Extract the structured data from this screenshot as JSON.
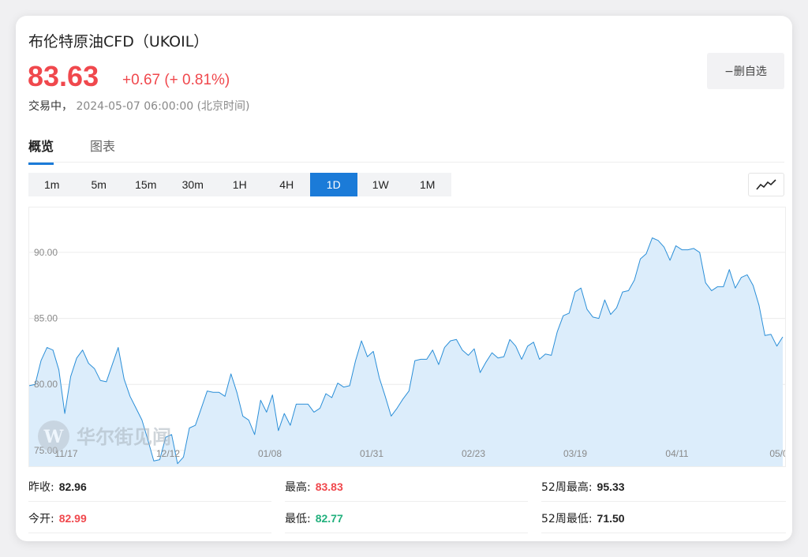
{
  "instrument": {
    "title": "布伦特原油CFD（UKOIL）",
    "price": "83.63",
    "change": "+0.67 (+ 0.81%)",
    "status_label": "交易中，",
    "timestamp": "2024-05-07 06:00:00 (北京时间)",
    "watch_label": "−删自选"
  },
  "tabs": [
    {
      "label": "概览",
      "active": true
    },
    {
      "label": "图表",
      "active": false
    }
  ],
  "periods": [
    {
      "label": "1m",
      "active": false
    },
    {
      "label": "5m",
      "active": false
    },
    {
      "label": "15m",
      "active": false
    },
    {
      "label": "30m",
      "active": false
    },
    {
      "label": "1H",
      "active": false
    },
    {
      "label": "4H",
      "active": false
    },
    {
      "label": "1D",
      "active": true
    },
    {
      "label": "1W",
      "active": false
    },
    {
      "label": "1M",
      "active": false
    }
  ],
  "chart_type_icon": "line-chart-icon",
  "watermark": "华尔街见闻",
  "stats": {
    "prev_close": {
      "label": "昨收:",
      "value": "82.96"
    },
    "high": {
      "label": "最高:",
      "value": "83.83"
    },
    "high52": {
      "label": "52周最高:",
      "value": "95.33"
    },
    "open": {
      "label": "今开:",
      "value": "82.99"
    },
    "low": {
      "label": "最低:",
      "value": "82.77"
    },
    "low52": {
      "label": "52周最低:",
      "value": "71.50"
    }
  },
  "colors": {
    "up": "#f0484d",
    "down": "#22b07d",
    "accent": "#1b7bd8",
    "line": "#2b8fd8",
    "fill": "#dcedfb"
  },
  "chart_data": {
    "type": "area",
    "y_ticks": [
      "75.00",
      "80.00",
      "85.00",
      "90.00"
    ],
    "x_ticks": [
      "11/17",
      "12/12",
      "01/08",
      "01/31",
      "02/23",
      "03/19",
      "04/11",
      "05/0"
    ],
    "ylim": [
      73.8,
      93.4
    ],
    "grid": true,
    "values": [
      79.9,
      80.0,
      81.8,
      82.8,
      82.6,
      81.1,
      77.8,
      80.6,
      82.0,
      82.6,
      81.6,
      81.2,
      80.3,
      80.2,
      81.5,
      82.8,
      80.4,
      79.1,
      78.2,
      77.3,
      75.8,
      74.2,
      74.3,
      76.0,
      76.2,
      74.0,
      74.5,
      76.7,
      76.9,
      78.2,
      79.5,
      79.4,
      79.4,
      79.1,
      80.8,
      79.4,
      77.6,
      77.3,
      76.2,
      78.8,
      77.9,
      79.2,
      76.5,
      77.8,
      76.9,
      78.5,
      78.5,
      78.5,
      77.9,
      78.2,
      79.3,
      79.0,
      80.1,
      79.8,
      79.9,
      81.8,
      83.3,
      82.1,
      82.5,
      80.5,
      79.1,
      77.6,
      78.2,
      78.9,
      79.5,
      81.8,
      81.9,
      81.9,
      82.6,
      81.5,
      82.8,
      83.3,
      83.4,
      82.6,
      82.2,
      82.7,
      80.9,
      81.7,
      82.4,
      82.0,
      82.1,
      83.4,
      82.9,
      81.9,
      82.9,
      83.2,
      81.9,
      82.3,
      82.2,
      84.0,
      85.2,
      85.4,
      87.0,
      87.3,
      85.7,
      85.1,
      85.0,
      86.4,
      85.3,
      85.8,
      87.0,
      87.1,
      87.9,
      89.5,
      89.9,
      91.1,
      90.9,
      90.4,
      89.4,
      90.5,
      90.2,
      90.2,
      90.3,
      90.0,
      87.7,
      87.1,
      87.4,
      87.4,
      88.7,
      87.3,
      88.1,
      88.3,
      87.5,
      86.0,
      83.7,
      83.8,
      82.9,
      83.6
    ]
  }
}
